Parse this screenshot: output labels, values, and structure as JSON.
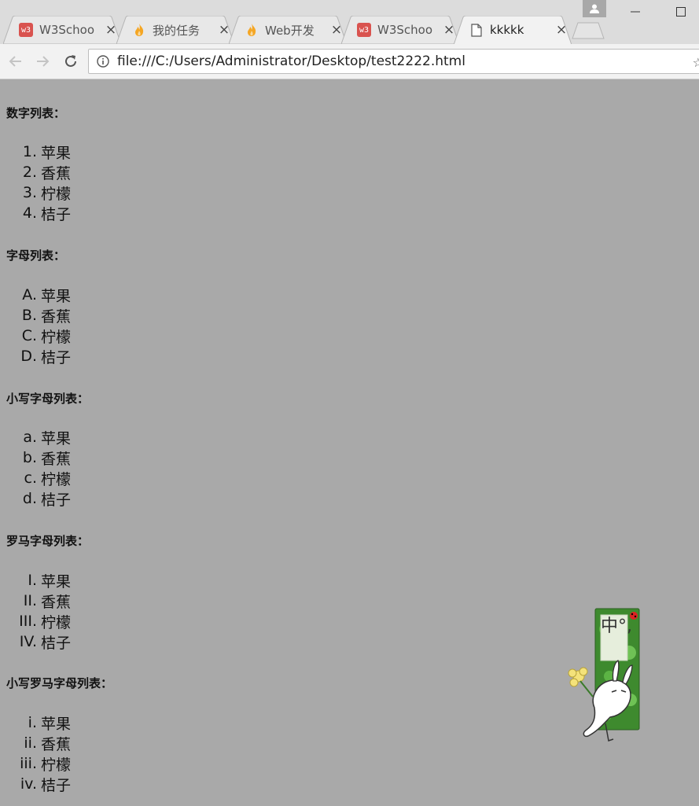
{
  "browser": {
    "tabs": [
      {
        "icon": "w3schools-icon",
        "icon_text": "w3",
        "title": "W3Schoo",
        "active": false
      },
      {
        "icon": "flame-icon",
        "icon_text": "",
        "title": "我的任务",
        "active": false
      },
      {
        "icon": "flame-icon",
        "icon_text": "",
        "title": "Web开发",
        "active": false
      },
      {
        "icon": "w3schools-icon",
        "icon_text": "w3",
        "title": "W3Schoo",
        "active": false
      },
      {
        "icon": "page-icon",
        "icon_text": "",
        "title": "kkkkk",
        "active": true
      }
    ],
    "close_glyph": "×",
    "address": "file:///C:/Users/Administrator/Desktop/test2222.html",
    "colors": {
      "page_bg": "#a9a9a9",
      "tabstrip": "#dcdcdc",
      "toolbar": "#f2f2f2",
      "w3": "#d9534f"
    }
  },
  "page": {
    "sections": [
      {
        "title": "数字列表：",
        "items": [
          {
            "marker": "1.",
            "text": "苹果"
          },
          {
            "marker": "2.",
            "text": "香蕉"
          },
          {
            "marker": "3.",
            "text": "柠檬"
          },
          {
            "marker": "4.",
            "text": "桔子"
          }
        ]
      },
      {
        "title": "字母列表：",
        "items": [
          {
            "marker": "A.",
            "text": "苹果"
          },
          {
            "marker": "B.",
            "text": "香蕉"
          },
          {
            "marker": "C.",
            "text": "柠檬"
          },
          {
            "marker": "D.",
            "text": "桔子"
          }
        ]
      },
      {
        "title": "小写字母列表：",
        "items": [
          {
            "marker": "a.",
            "text": "苹果"
          },
          {
            "marker": "b.",
            "text": "香蕉"
          },
          {
            "marker": "c.",
            "text": "柠檬"
          },
          {
            "marker": "d.",
            "text": "桔子"
          }
        ]
      },
      {
        "title": "罗马字母列表：",
        "items": [
          {
            "marker": "I.",
            "text": "苹果"
          },
          {
            "marker": "II.",
            "text": "香蕉"
          },
          {
            "marker": "III.",
            "text": "柠檬"
          },
          {
            "marker": "IV.",
            "text": "桔子"
          }
        ]
      },
      {
        "title": "小写罗马字母列表：",
        "items": [
          {
            "marker": "i.",
            "text": "苹果"
          },
          {
            "marker": "ii.",
            "text": "香蕉"
          },
          {
            "marker": "iii.",
            "text": "柠檬"
          },
          {
            "marker": "iv.",
            "text": "桔子"
          }
        ]
      }
    ],
    "sticker": {
      "icon": "rabbit-ime-sticker",
      "label": "中°,"
    }
  }
}
